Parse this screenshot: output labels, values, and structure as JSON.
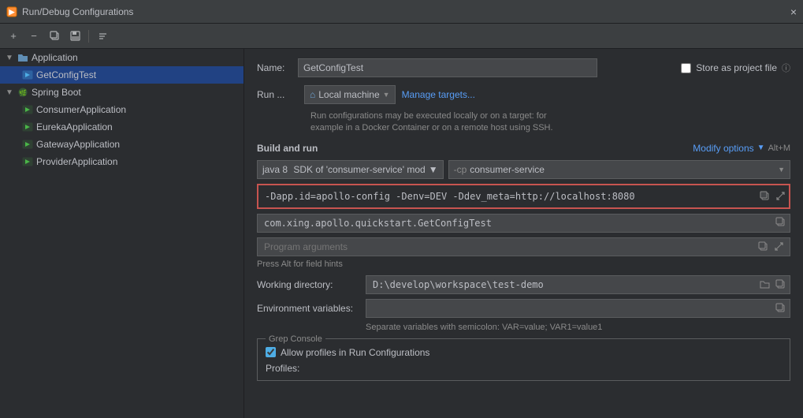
{
  "titlebar": {
    "title": "Run/Debug Configurations",
    "close_label": "×"
  },
  "toolbar": {
    "add_label": "+",
    "remove_label": "−",
    "copy_label": "⧉",
    "save_label": "💾",
    "move_label": "⇅"
  },
  "sidebar": {
    "items": [
      {
        "id": "application",
        "label": "Application",
        "indent": 0,
        "type": "folder",
        "expanded": true
      },
      {
        "id": "getconfigtest",
        "label": "GetConfigTest",
        "indent": 1,
        "type": "config",
        "selected": true
      },
      {
        "id": "springboot",
        "label": "Spring Boot",
        "indent": 0,
        "type": "springboot",
        "expanded": true
      },
      {
        "id": "consumerapplication",
        "label": "ConsumerApplication",
        "indent": 1,
        "type": "app"
      },
      {
        "id": "eurekaapplication",
        "label": "EurekaApplication",
        "indent": 1,
        "type": "app"
      },
      {
        "id": "gatewayapplication",
        "label": "GatewayApplication",
        "indent": 1,
        "type": "app"
      },
      {
        "id": "providerapplication",
        "label": "ProviderApplication",
        "indent": 1,
        "type": "app"
      }
    ]
  },
  "content": {
    "name_label": "Name:",
    "name_value": "GetConfigTest",
    "store_project_label": "Store as project file",
    "run_label": "Run ...",
    "run_target": "Local machine",
    "manage_targets": "Manage targets...",
    "run_hint": "Run configurations may be executed locally or on a target: for\nexample in a Docker Container or on a remote host using SSH.",
    "build_run_label": "Build and run",
    "modify_options_label": "Modify options",
    "modify_options_shortcut": "Alt+M",
    "sdk_value": "java 8",
    "sdk_suffix": "SDK of 'consumer-service' mod",
    "cp_prefix": "-cp",
    "cp_value": "consumer-service",
    "vm_options_value": "-Dapp.id=apollo-config -Denv=DEV -Ddev_meta=http://localhost:8080",
    "main_class_value": "com.xing.apollo.quickstart.GetConfigTest",
    "program_args_placeholder": "Program arguments",
    "field_hints": "Press Alt for field hints",
    "working_dir_label": "Working directory:",
    "working_dir_value": "D:\\develop\\workspace\\test-demo",
    "env_vars_label": "Environment variables:",
    "env_vars_hint": "Separate variables with semicolon: VAR=value; VAR1=value1",
    "grep_title": "Grep Console",
    "grep_checkbox_label": "Allow profiles in Run Configurations",
    "profiles_label": "Profiles:"
  }
}
